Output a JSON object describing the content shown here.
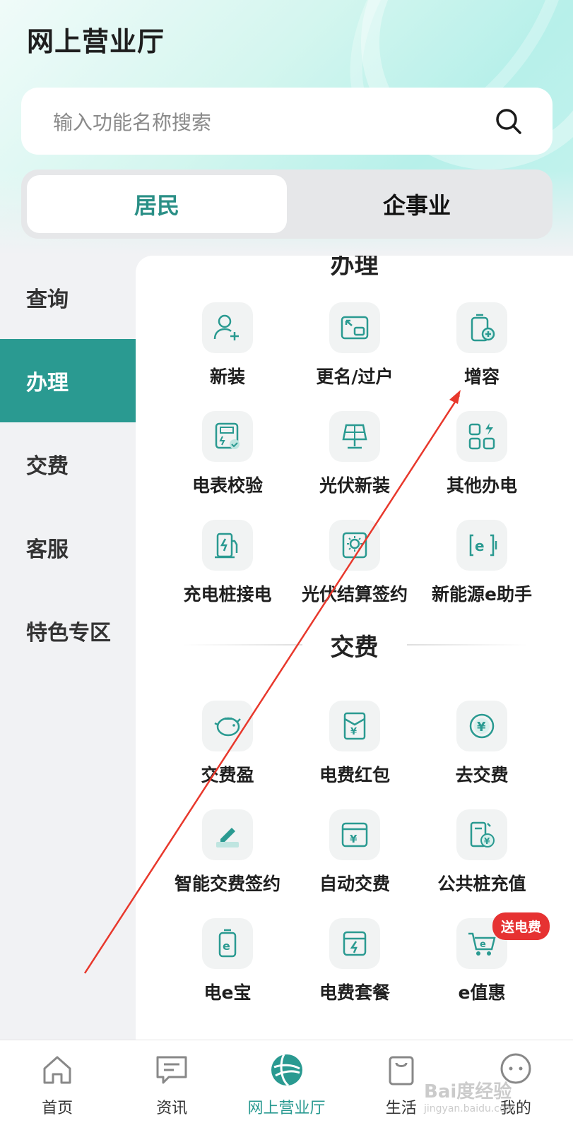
{
  "page": {
    "title": "网上营业厅"
  },
  "search": {
    "placeholder": "输入功能名称搜索"
  },
  "segments": [
    {
      "label": "居民",
      "active": true
    },
    {
      "label": "企事业",
      "active": false
    }
  ],
  "sidebar": {
    "items": [
      {
        "label": "查询",
        "active": false
      },
      {
        "label": "办理",
        "active": true
      },
      {
        "label": "交费",
        "active": false
      },
      {
        "label": "客服",
        "active": false
      },
      {
        "label": "特色专区",
        "active": false
      }
    ]
  },
  "handle_section": {
    "title_partial": "办理",
    "items": [
      {
        "label": "新装",
        "icon": "add-user-icon"
      },
      {
        "label": "更名/过户",
        "icon": "transfer-icon"
      },
      {
        "label": "增容",
        "icon": "capacity-add-icon"
      },
      {
        "label": "电表校验",
        "icon": "meter-check-icon"
      },
      {
        "label": "光伏新装",
        "icon": "solar-panel-icon"
      },
      {
        "label": "其他办电",
        "icon": "apps-icon"
      },
      {
        "label": "充电桩接电",
        "icon": "charging-pile-icon"
      },
      {
        "label": "光伏结算签约",
        "icon": "solar-settlement-icon"
      },
      {
        "label": "新能源e助手",
        "icon": "e-assistant-icon"
      }
    ]
  },
  "pay_section": {
    "title": "交费",
    "items": [
      {
        "label": "交费盈",
        "icon": "piggy-bank-icon"
      },
      {
        "label": "电费红包",
        "icon": "red-envelope-icon"
      },
      {
        "label": "去交费",
        "icon": "yuan-coin-icon"
      },
      {
        "label": "智能交费签约",
        "icon": "sign-pen-icon"
      },
      {
        "label": "自动交费",
        "icon": "auto-pay-icon"
      },
      {
        "label": "公共桩充值",
        "icon": "public-pile-icon"
      },
      {
        "label": "电e宝",
        "icon": "e-battery-icon"
      },
      {
        "label": "电费套餐",
        "icon": "package-icon"
      },
      {
        "label": "e值惠",
        "icon": "cart-icon",
        "badge": "送电费"
      }
    ]
  },
  "bottom_nav": [
    {
      "label": "首页",
      "icon": "home-icon",
      "active": false
    },
    {
      "label": "资讯",
      "icon": "news-icon",
      "active": false
    },
    {
      "label": "网上营业厅",
      "icon": "globe-icon",
      "active": true
    },
    {
      "label": "生活",
      "icon": "bag-icon",
      "active": false
    },
    {
      "label": "我的",
      "icon": "profile-icon",
      "active": false
    }
  ],
  "colors": {
    "accent": "#2a9a91",
    "accent_text": "#2a8f86",
    "badge": "#e63232",
    "annotation_arrow": "#e8382c"
  },
  "watermark": {
    "brand": "Bai度经验",
    "url": "jingyan.baidu.com"
  }
}
